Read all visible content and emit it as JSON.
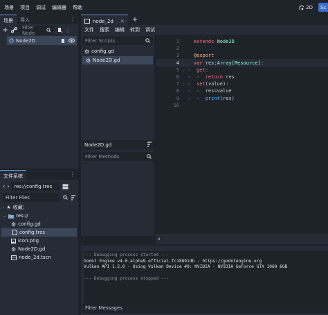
{
  "menu": {
    "items": [
      "场景",
      "项目",
      "调试",
      "编辑器",
      "帮助"
    ],
    "view_2d": "2D",
    "script_label": "Sc"
  },
  "scene_dock": {
    "tabs": [
      "场景",
      "导入"
    ],
    "filter_placeholder": "Filter Node",
    "root_node": "Node2D"
  },
  "filesystem_dock": {
    "tab": "文件系统",
    "path": "res://config.tres",
    "filter_placeholder": "Filter Files",
    "favorites_label": "收藏：",
    "root_label": "res://",
    "files": [
      "config.gd",
      "config.tres",
      "icon.png",
      "Node2D.gd",
      "node_2d.tscn"
    ]
  },
  "script_editor": {
    "tab": "node_2d",
    "menu": [
      "文件",
      "搜索",
      "编辑",
      "转到",
      "调试"
    ],
    "scripts_filter_placeholder": "Filter Scripts",
    "scripts": [
      "config.gd",
      "Node2D.gd"
    ],
    "current_script": "Node2D.gd",
    "methods_filter_placeholder": "Filter Methods",
    "line_numbers": [
      "1",
      "2",
      "3",
      "4",
      "5",
      "6",
      "7",
      "8",
      "9",
      "10"
    ],
    "code": {
      "l1_kw": "extends",
      "l1_ty": " Node2D",
      "l3_an": "@export",
      "l4_kw": "var",
      "l4_tx": " res:",
      "l4_ty": "Array",
      "l4_tx2": "[",
      "l4_ty2": "Resource",
      "l4_tx3": "]:",
      "l5_kw": "get",
      "l5_tx": ":",
      "l6_kw": "return",
      "l6_tx": " res",
      "l7_kw": "set",
      "l7_tx": "(value):",
      "l8_tx": "res=value",
      "l9_fn": "print",
      "l9_tx": "(res)"
    }
  },
  "output": {
    "lines": [
      "--- Debugging process started ---",
      "Godot Engine v4.0.alpha9.official.fc18891db - https://godotengine.org",
      "Vulkan API 1.2.0 - Using Vulkan Device #0: NVIDIA - NVIDIA GeForce GTX 1060 6GB",
      "",
      "--- Debugging process stopped ---"
    ],
    "filter_placeholder": "Filter Messages"
  },
  "colors": {
    "accent": "#3c6cd2",
    "selection": "#3b4658",
    "keyword": "#ff7085",
    "type": "#8effda",
    "function": "#57b3ff",
    "annotation": "#ffb373"
  }
}
